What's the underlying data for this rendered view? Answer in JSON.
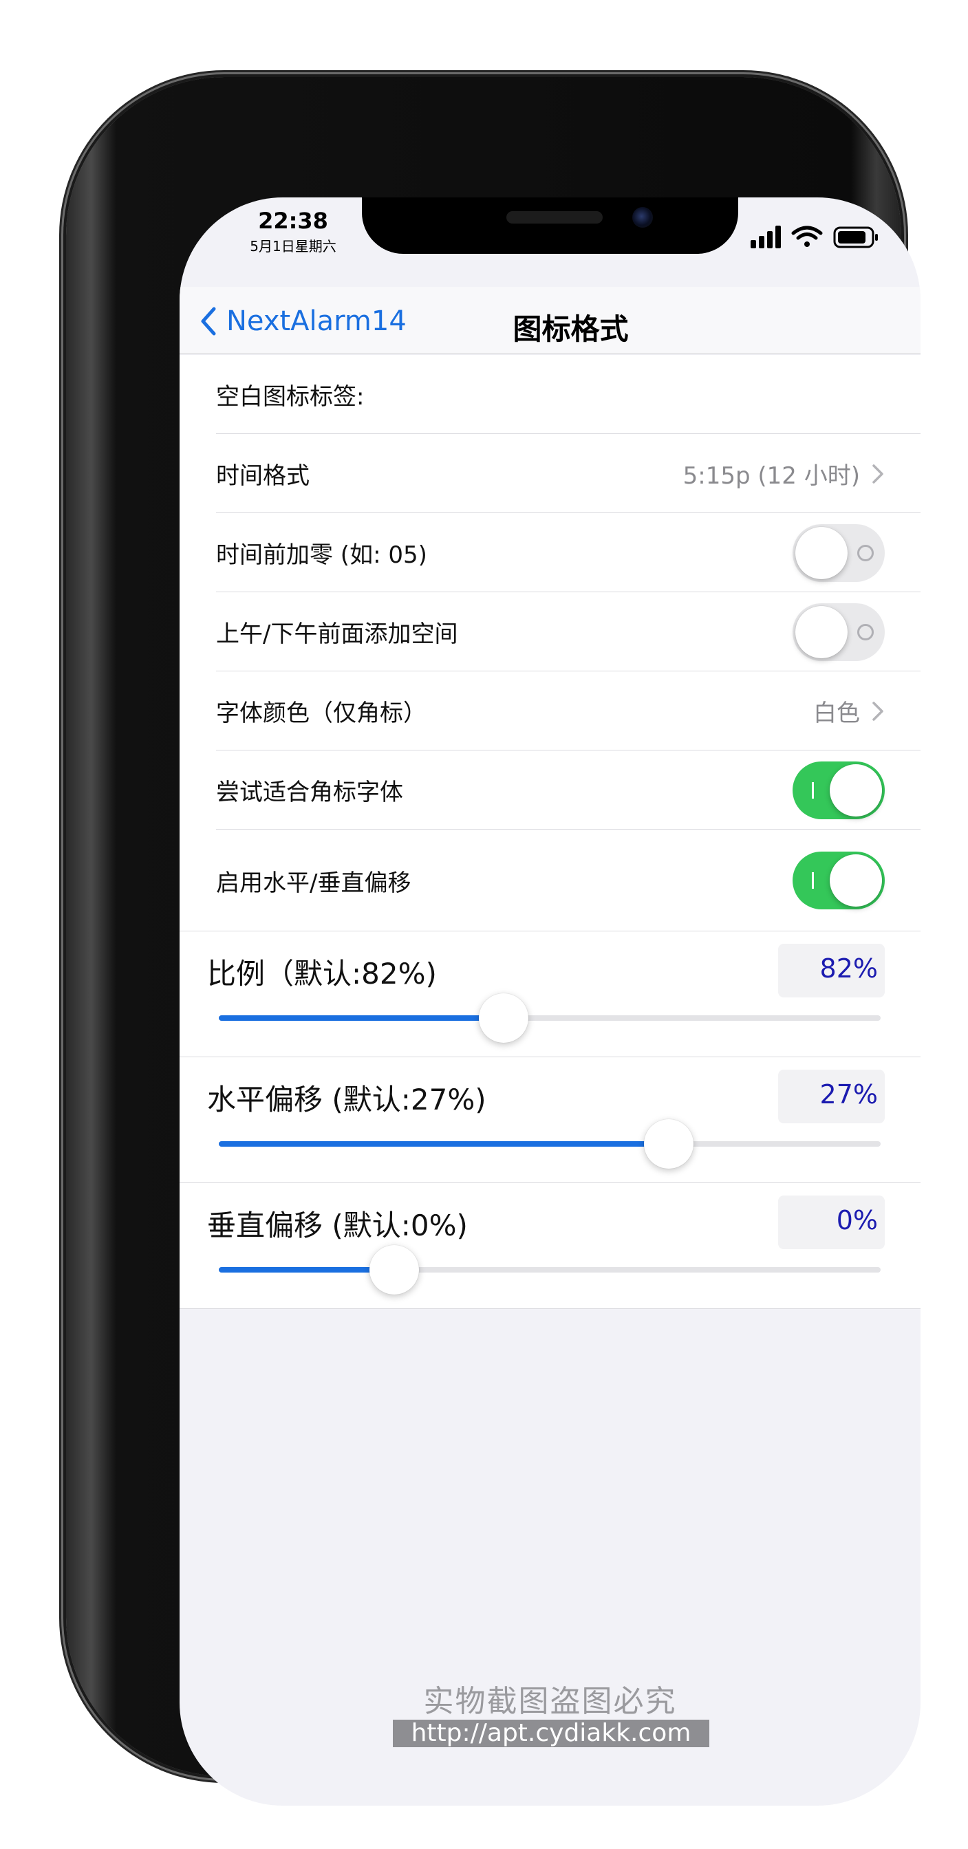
{
  "status_bar": {
    "time": "22:38",
    "date": "5月1日星期六"
  },
  "navbar": {
    "back_label": "NextAlarm14",
    "title": "图标格式"
  },
  "rows": {
    "blank_label": "空白图标标签:",
    "time_format": {
      "label": "时间格式",
      "value": "5:15p (12 小时)"
    },
    "leading_zero": {
      "label": "时间前加零 (如: 05)",
      "on": false
    },
    "ampm_space": {
      "label": "上午/下午前面添加空间",
      "on": false
    },
    "font_color": {
      "label": "字体颜色（仅角标）",
      "value": "白色"
    },
    "fit_badge_font": {
      "label": "尝试适合角标字体",
      "on": true
    },
    "enable_offset": {
      "label": "启用水平/垂直偏移",
      "on": true
    }
  },
  "sliders": [
    {
      "title": "比例（默认:82%)",
      "value": "82%",
      "fill_fraction": 0.43
    },
    {
      "title": "水平偏移 (默认:27%)",
      "value": "27%",
      "fill_fraction": 0.68
    },
    {
      "title": "垂直偏移 (默认:0%)",
      "value": "0%",
      "fill_fraction": 0.265
    }
  ],
  "watermark": {
    "line1": "实物截图盗图必究",
    "line2": "http://apt.cydiakk.com"
  },
  "colors": {
    "accent": "#1a6fe0",
    "toggle_on": "#34c759",
    "value_text": "#1b1bb0"
  }
}
